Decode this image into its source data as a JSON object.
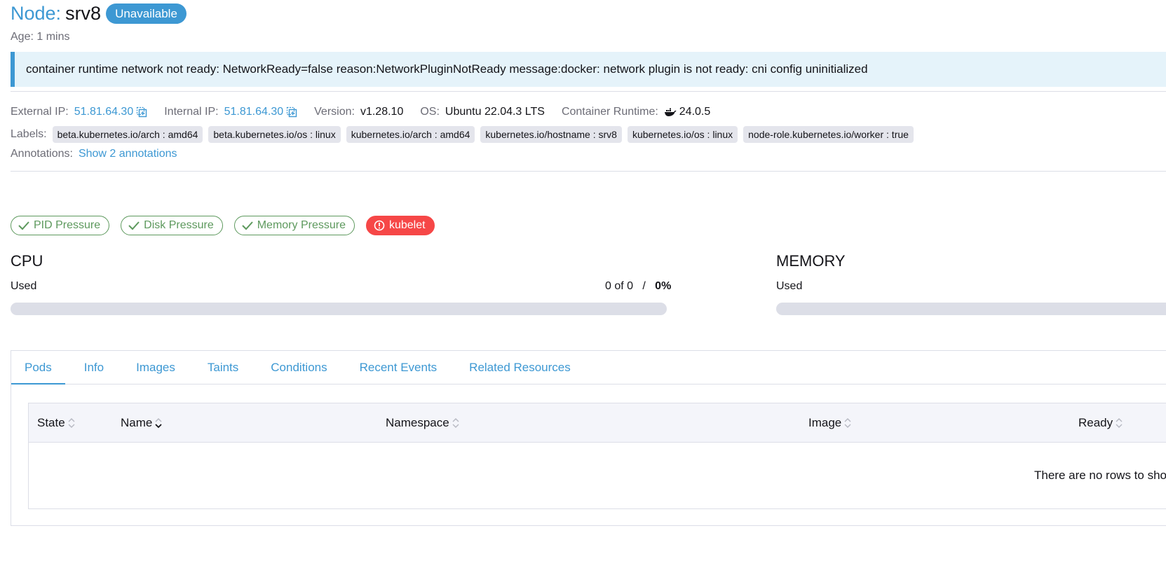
{
  "header": {
    "title_prefix": "Node:",
    "node_name": "srv8",
    "state": "Unavailable",
    "age_label": "Age:",
    "age_value": "1 mins"
  },
  "banner": {
    "message": "container runtime network not ready: NetworkReady=false reason:NetworkPluginNotReady message:docker: network plugin is not ready: cni config uninitialized"
  },
  "details": {
    "external_ip_label": "External IP:",
    "external_ip": "51.81.64.30",
    "internal_ip_label": "Internal IP:",
    "internal_ip": "51.81.64.30",
    "version_label": "Version:",
    "version": "v1.28.10",
    "os_label": "OS:",
    "os": "Ubuntu 22.04.3 LTS",
    "runtime_label": "Container Runtime:",
    "runtime": "24.0.5",
    "labels_label": "Labels:",
    "labels": [
      "beta.kubernetes.io/arch : amd64",
      "beta.kubernetes.io/os : linux",
      "kubernetes.io/arch : amd64",
      "kubernetes.io/hostname : srv8",
      "kubernetes.io/os : linux",
      "node-role.kubernetes.io/worker : true"
    ],
    "annotations_label": "Annotations:",
    "annotations_link": "Show 2 annotations"
  },
  "conditions": [
    {
      "label": "PID Pressure",
      "status": "ok"
    },
    {
      "label": "Disk Pressure",
      "status": "ok"
    },
    {
      "label": "Memory Pressure",
      "status": "ok"
    },
    {
      "label": "kubelet",
      "status": "error"
    }
  ],
  "gauges": {
    "cpu": {
      "title": "CPU",
      "used_label": "Used",
      "amount": "0 of 0",
      "separator": "/",
      "percent": "0%",
      "fill_fraction": 0
    },
    "memory": {
      "title": "MEMORY",
      "used_label": "Used",
      "fill_fraction": 0
    }
  },
  "tabs": [
    "Pods",
    "Info",
    "Images",
    "Taints",
    "Conditions",
    "Recent Events",
    "Related Resources"
  ],
  "active_tab": "Pods",
  "table": {
    "columns": [
      "State",
      "Name",
      "Namespace",
      "Image",
      "Ready"
    ],
    "sorted_column": "Name",
    "empty_message": "There are no rows to show."
  },
  "colors": {
    "accent": "#3d98d3",
    "ok": "#5d995d",
    "error": "#f64747",
    "banner_bg": "#e5f3fa"
  }
}
